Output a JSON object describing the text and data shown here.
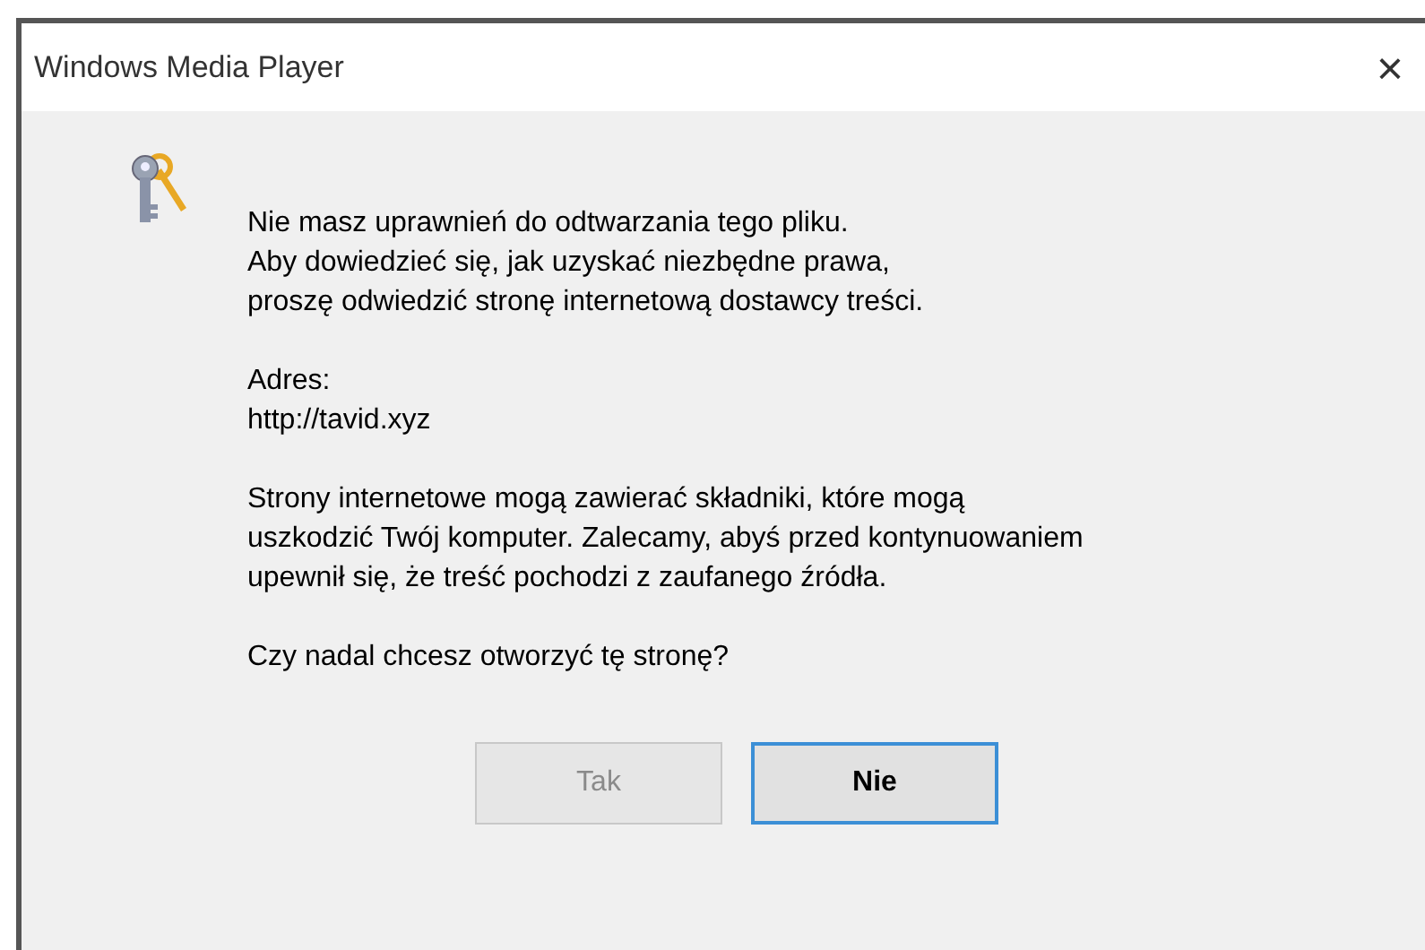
{
  "window": {
    "title": "Windows Media Player",
    "close": "×"
  },
  "message": {
    "paragraphs": [
      "Nie masz uprawnień do odtwarzania tego pliku.\nAby dowiedzieć się, jak uzyskać niezbędne prawa,\nproszę odwiedzić stronę internetową dostawcy treści.",
      "Adres:\nhttp://tavid.xyz",
      "Strony internetowe mogą zawierać składniki, które mogą\nuszkodzić Twój komputer. Zalecamy, abyś przed kontynuowaniem\nupewnił się, że treść pochodzi z zaufanego źródła.",
      "Czy nadal chcesz otworzyć tę stronę?"
    ]
  },
  "buttons": [
    {
      "label": "Tak",
      "disabled": true,
      "default": false
    },
    {
      "label": "Nie",
      "disabled": false,
      "default": true
    }
  ]
}
